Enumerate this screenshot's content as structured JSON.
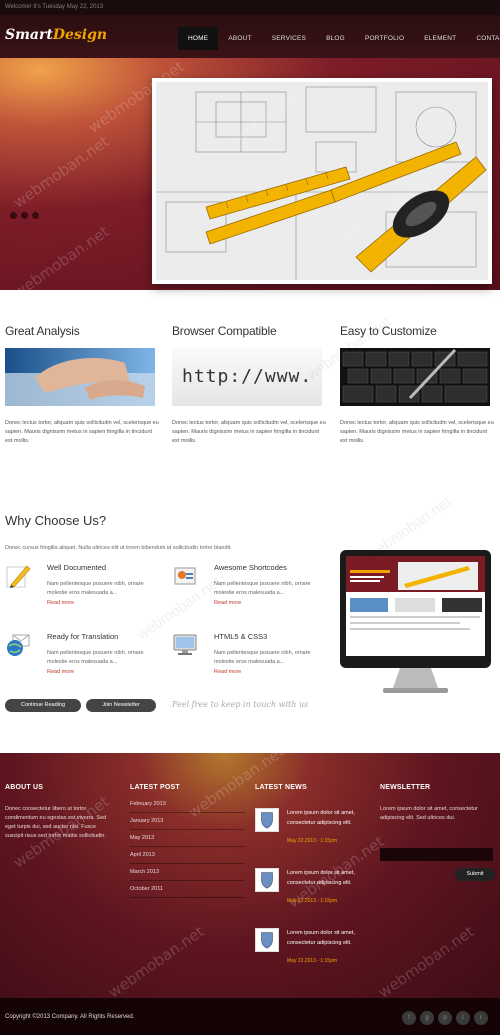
{
  "topbar": {
    "welcome": "Welcome! It's Tuesday May 22, 2013"
  },
  "logo": {
    "part1": "Smart",
    "part2": "Design"
  },
  "nav": [
    "HOME",
    "ABOUT",
    "SERVICES",
    "BLOG",
    "PORTFOLIO",
    "ELEMENT",
    "CONTACT"
  ],
  "features": [
    {
      "title": "Great Analysis",
      "text": "Donec lectus tortor, aliquam quis sollicitudin vel, scelerisque eu sapien. Mauris dignissim metus in sapien fringilla in tincidunt est mollis."
    },
    {
      "title": "Browser Compatible",
      "text": "Donec lectus tortor, aliquam quis sollicitudin vel, scelerisque eu sapien. Mauris dignissim metus in sapien fringilla in tincidunt est mollis."
    },
    {
      "title": "Easy to Customize",
      "text": "Donec lectus tortor, aliquam quis sollicitudin vel, scelerisque eu sapien. Mauris dignissim metus in sapien fringilla in tincidunt est mollis."
    }
  ],
  "browser_pic_text": "http://www.",
  "why": {
    "title": "Why Choose Us?",
    "lead": "Donec cursus fringilla aliquet. Nulla ultrices elit ut lorem bibendum id sollicitudin tortor blandit.",
    "items": [
      {
        "title": "Well Documented",
        "text": "Nam pellentesque posuere nibh, ornare molestie eros malesuada a...",
        "link": "Read more",
        "icon": "pencil-icon"
      },
      {
        "title": "Awesome Shortcodes",
        "text": "Nam pellentesque posuere nibh, ornare molestie eros malesuada a...",
        "link": "Read more",
        "icon": "shortcodes-icon"
      },
      {
        "title": "Ready for Translation",
        "text": "Nam pellentesque posuere nibh, ornare molestie eros malesuada a...",
        "link": "Read more",
        "icon": "globe-mail-icon"
      },
      {
        "title": "HTML5 & CSS3",
        "text": "Nam pellentesque posuere nibh, ornare molestie eros malesuada a...",
        "link": "Read more",
        "icon": "monitor-icon"
      }
    ],
    "btn_reading": "Continue Reading",
    "btn_newsletter": "Join Newsletter",
    "tagline": "Feel free to keep in touch with us"
  },
  "footer": {
    "about": {
      "title": "ABOUT US",
      "text": "Donec consectetur libero ut tortor condimentum eu egestas est viverra. Sed eget turpis dui, sed auctor nisi. Fusce suscipit risus sed tortor mattis sollicitudin."
    },
    "latest_post": {
      "title": "LATEST POST",
      "items": [
        "February 2013",
        "January 2013",
        "May 2013",
        "April 2013",
        "March 2013",
        "October 2011"
      ]
    },
    "latest_news": {
      "title": "LATEST NEWS",
      "items": [
        {
          "text": "Lorem ipsum dolor sit amet, consectetur adipiscing elit.",
          "date": "May 22,2013 - 1:15pm"
        },
        {
          "text": "Lorem ipsum dolor sit amet, consectetur adipiscing elit.",
          "date": "May 22,2013 - 1:15pm"
        },
        {
          "text": "Lorem ipsum dolor sit amet, consectetur adipiscing elit.",
          "date": "May 22,2013 - 1:15pm"
        }
      ]
    },
    "newsletter": {
      "title": "NEWSLETTER",
      "text": "Lorem ipsum dolor sit amet, consectetur adipiscing elit. Sed ultrices dui.",
      "submit": "Submit"
    }
  },
  "copyright": "Copyright ©2013 Company. All Rights Reserved.",
  "social": [
    "f",
    "g",
    "p",
    "t",
    "r"
  ],
  "watermark": "webmoban.net",
  "colors": {
    "accent": "#f0a400",
    "link": "#c0392b",
    "dark": "#3e0d15"
  }
}
